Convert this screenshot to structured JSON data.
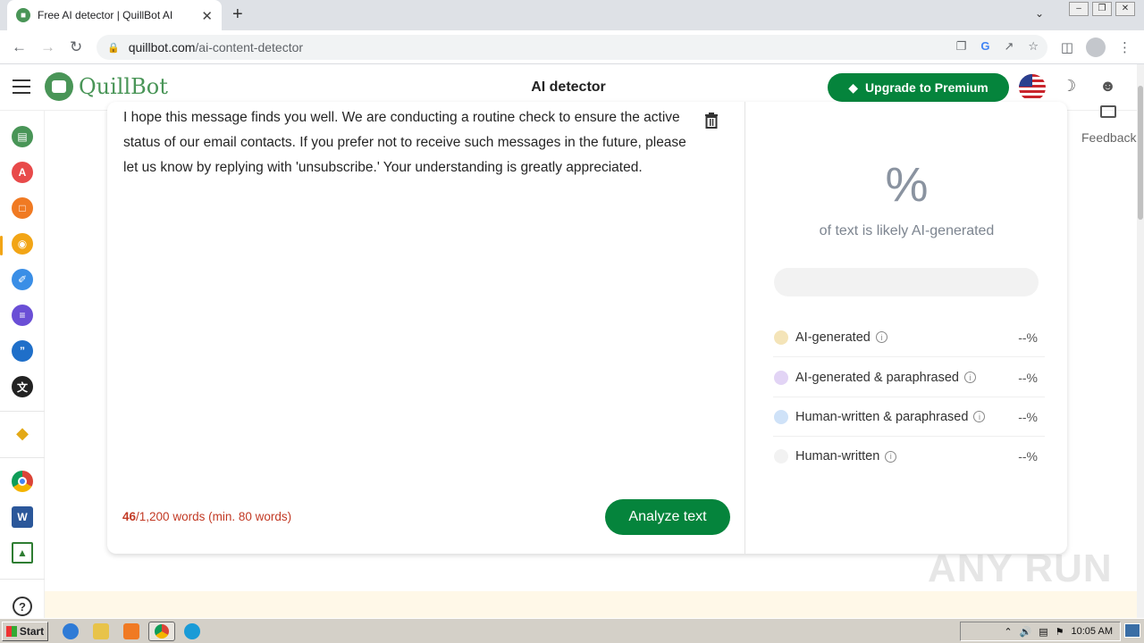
{
  "browser": {
    "tab_title": "Free AI detector | QuillBot AI",
    "url_domain": "quillbot.com",
    "url_path": "/ai-content-detector"
  },
  "header": {
    "brand": "QuillBot",
    "title": "AI detector",
    "upgrade_label": "Upgrade to Premium",
    "feedback_label": "Feedback"
  },
  "editor": {
    "text": "I hope this message finds you well. We are conducting a routine check to ensure the active status of our email contacts. If you prefer not to receive such messages in the future, please let us know by replying with 'unsubscribe.' Your understanding is greatly appreciated.",
    "word_count": "46",
    "word_limit": "/1,200 words (min. 80 words)",
    "analyze_label": "Analyze text"
  },
  "results": {
    "percent": "%",
    "percent_label": "of text is likely AI-generated",
    "categories": [
      {
        "label": "AI-generated",
        "value": "--%",
        "color": "#f4e4b8"
      },
      {
        "label": "AI-generated & paraphrased",
        "value": "--%",
        "color": "#e2d4f5"
      },
      {
        "label": "Human-written & paraphrased",
        "value": "--%",
        "color": "#cfe2f8"
      },
      {
        "label": "Human-written",
        "value": "--%",
        "color": "#f2f2f2"
      }
    ]
  },
  "sidebar": {
    "icons": [
      "paraphraser-icon",
      "grammar-checker-icon",
      "plagiarism-checker-icon",
      "ai-detector-icon",
      "summarizer-icon",
      "citation-icon",
      "quotes-icon",
      "translator-icon",
      "premium-icon",
      "chrome-extension-icon",
      "word-addin-icon",
      "desktop-app-icon",
      "help-icon"
    ]
  },
  "taskbar": {
    "start_label": "Start",
    "clock": "10:05 AM"
  },
  "watermark": "ANY RUN"
}
